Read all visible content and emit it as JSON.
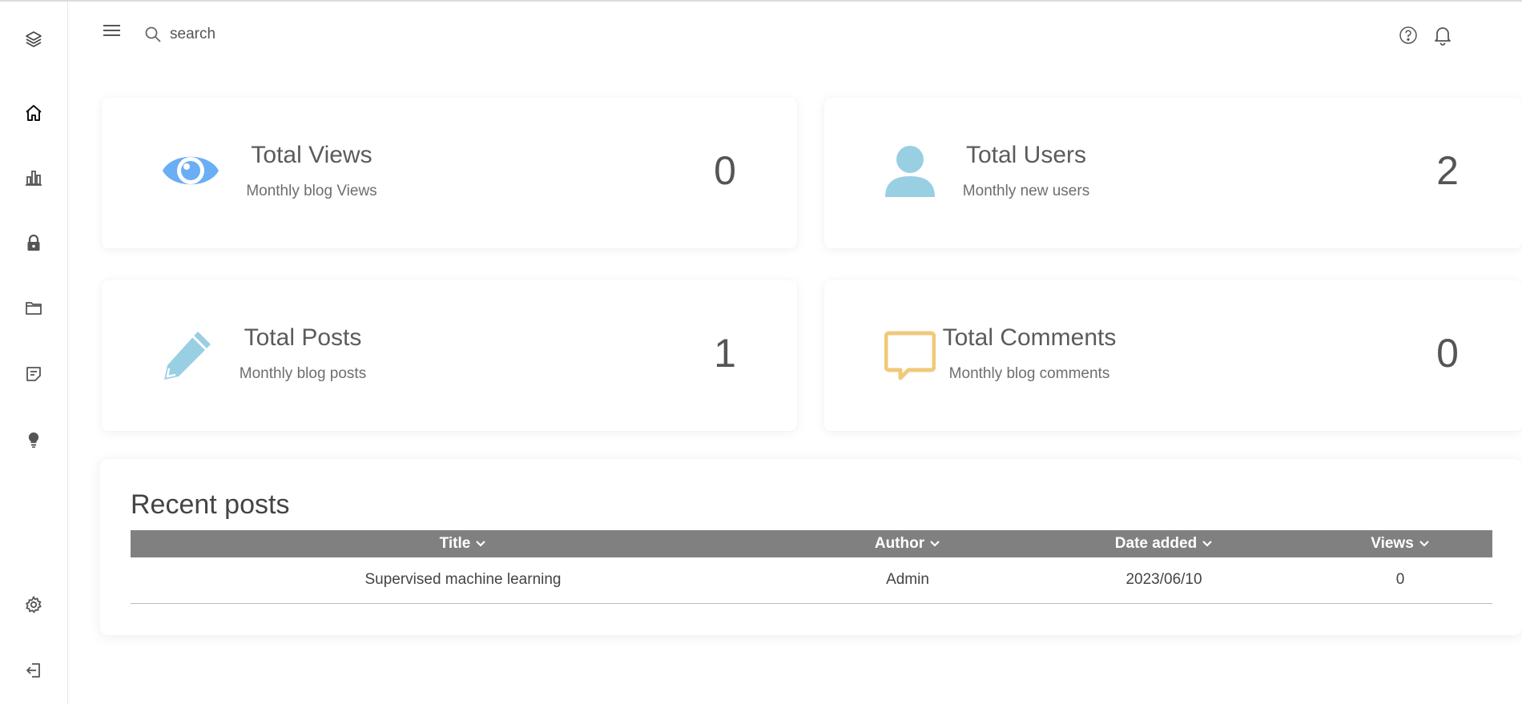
{
  "search": {
    "placeholder": "search"
  },
  "cards": [
    {
      "title": "Total Views",
      "subtitle": "Monthly blog Views",
      "value": "0",
      "icon": "eye-icon",
      "color": "#6aaef5"
    },
    {
      "title": "Total Users",
      "subtitle": "Monthly new users",
      "value": "2",
      "icon": "user-icon",
      "color": "#99cfe3"
    },
    {
      "title": "Total Posts",
      "subtitle": "Monthly blog posts",
      "value": "1",
      "icon": "pencil-icon",
      "color": "#99cfe3"
    },
    {
      "title": "Total Comments",
      "subtitle": "Monthly blog comments",
      "value": "0",
      "icon": "comment-icon",
      "color": "#f0c97a"
    }
  ],
  "recent_posts": {
    "title": "Recent posts",
    "columns": [
      "Title",
      "Author",
      "Date added",
      "Views"
    ],
    "rows": [
      [
        "Supervised machine learning",
        "Admin",
        "2023/06/10",
        "0"
      ]
    ]
  },
  "sidebar": {
    "items": [
      "layers-icon",
      "home-icon",
      "chart-icon",
      "lock-icon",
      "folder-icon",
      "note-icon",
      "bulb-icon",
      "settings-icon",
      "logout-icon"
    ]
  },
  "colors": {
    "table_header": "#808080",
    "accent_blue": "#6aaef5",
    "accent_light_blue": "#99cfe3",
    "accent_yellow": "#f0c97a"
  }
}
